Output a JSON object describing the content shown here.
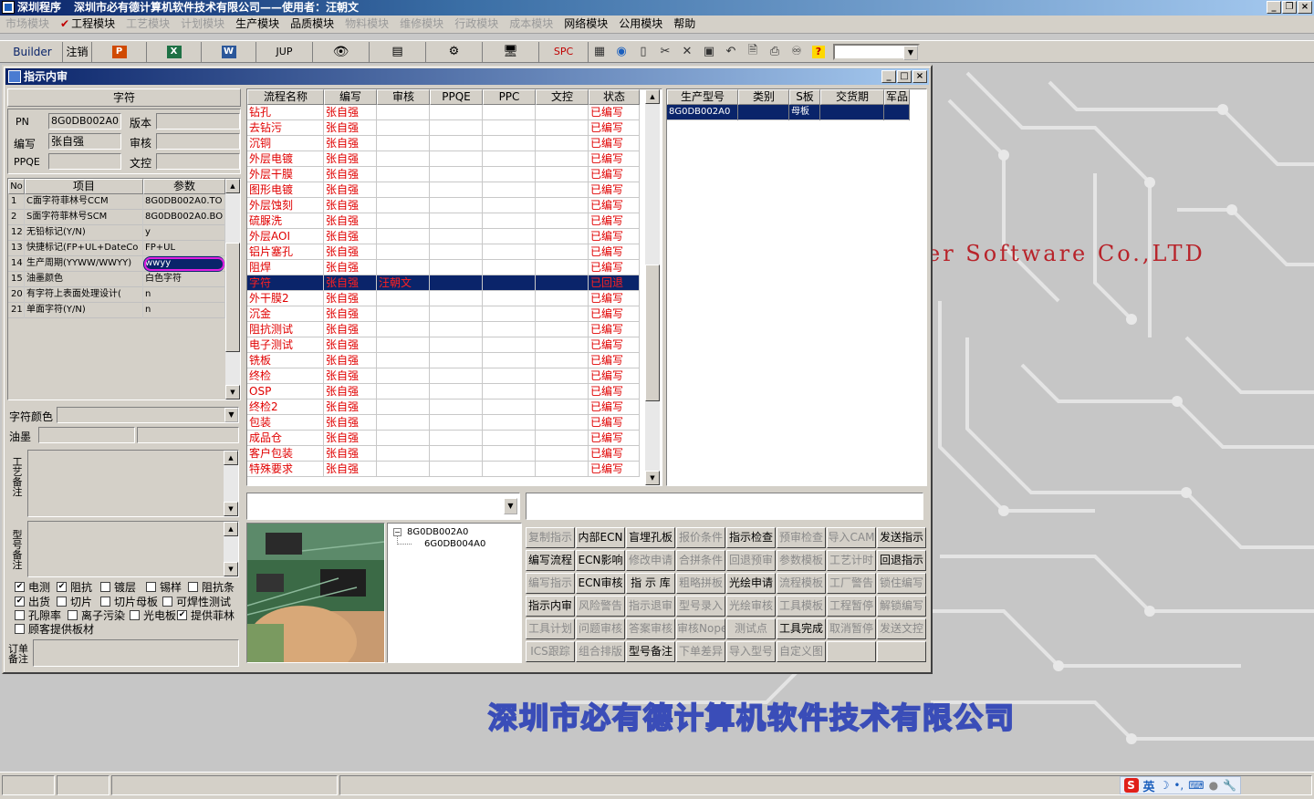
{
  "app": {
    "name": "深圳程序",
    "title": "深圳市必有德计算机软件技术有限公司——使用者：汪朝文"
  },
  "menu": [
    {
      "label": "市场模块",
      "enabled": false
    },
    {
      "label": "工程模块",
      "enabled": true,
      "checked": true
    },
    {
      "label": "工艺模块",
      "enabled": false
    },
    {
      "label": "计划模块",
      "enabled": false
    },
    {
      "label": "生产模块",
      "enabled": true
    },
    {
      "label": "品质模块",
      "enabled": true
    },
    {
      "label": "物料模块",
      "enabled": false
    },
    {
      "label": "维修模块",
      "enabled": false
    },
    {
      "label": "行政模块",
      "enabled": false
    },
    {
      "label": "成本模块",
      "enabled": false
    },
    {
      "label": "网络模块",
      "enabled": true
    },
    {
      "label": "公用模块",
      "enabled": true
    },
    {
      "label": "帮助",
      "enabled": true
    }
  ],
  "toolbar": {
    "builder": "Builder",
    "logout": "注销",
    "jup": "JUP",
    "spc": "SPC"
  },
  "window": {
    "title": "指示内审"
  },
  "left": {
    "section_title": "字符",
    "pn_label": "PN",
    "pn_value": "8G0DB002A0",
    "version_label": "版本",
    "version_value": "",
    "editor_label": "编写",
    "editor_value": "张自强",
    "review_label": "审核",
    "review_value": "",
    "ppqe_label": "PPQE",
    "ppqe_value": "",
    "doc_label": "文控",
    "doc_value": "",
    "params_headers": [
      "No",
      "项目",
      "参数"
    ],
    "params": [
      {
        "no": "1",
        "item": "C面字符菲林号CCM",
        "value": "8G0DB002A0.TO"
      },
      {
        "no": "2",
        "item": "S面字符菲林号SCM",
        "value": "8G0DB002A0.BO"
      },
      {
        "no": "12",
        "item": "无铅标记(Y/N)",
        "value": "y"
      },
      {
        "no": "13",
        "item": "快捷标记(FP+UL+DateCo",
        "value": "FP+UL"
      },
      {
        "no": "14",
        "item": "生产周期(YYWW/WWYY)",
        "value": "wwyy"
      },
      {
        "no": "15",
        "item": "油墨颜色",
        "value": "白色字符"
      },
      {
        "no": "20",
        "item": "有字符上表面处理设计(",
        "value": "n"
      },
      {
        "no": "21",
        "item": "单面字符(Y/N)",
        "value": "n"
      }
    ],
    "color_label": "字符颜色",
    "color_value": "",
    "ink_label": "油墨",
    "process_note_label": "工艺备注",
    "model_note_label": "型号备注",
    "checkboxes": [
      {
        "label": "电测",
        "checked": true
      },
      {
        "label": "阻抗",
        "checked": true
      },
      {
        "label": "镀层",
        "checked": false
      },
      {
        "label": "锡样",
        "checked": false
      },
      {
        "label": "阻抗条",
        "checked": false
      },
      {
        "label": "出货",
        "checked": true
      },
      {
        "label": "切片",
        "checked": false
      },
      {
        "label": "切片母板",
        "checked": false
      },
      {
        "label": "可焊性测试",
        "checked": false
      },
      {
        "label": "孔隙率",
        "checked": false
      },
      {
        "label": "离子污染",
        "checked": false
      },
      {
        "label": "光电板",
        "checked": false
      },
      {
        "label": "提供菲林",
        "checked": true
      },
      {
        "label": "顾客提供板材",
        "checked": false
      }
    ],
    "order_note_label": "订单备注"
  },
  "flow": {
    "headers": [
      "流程名称",
      "编写",
      "审核",
      "PPQE",
      "PPC",
      "文控",
      "状态"
    ],
    "rows": [
      {
        "name": "钻孔",
        "editor": "张自强",
        "review": "",
        "status": "已编写"
      },
      {
        "name": "去钻污",
        "editor": "张自强",
        "review": "",
        "status": "已编写"
      },
      {
        "name": "沉铜",
        "editor": "张自强",
        "review": "",
        "status": "已编写"
      },
      {
        "name": "外层电镀",
        "editor": "张自强",
        "review": "",
        "status": "已编写"
      },
      {
        "name": "外层干膜",
        "editor": "张自强",
        "review": "",
        "status": "已编写"
      },
      {
        "name": "图形电镀",
        "editor": "张自强",
        "review": "",
        "status": "已编写"
      },
      {
        "name": "外层蚀刻",
        "editor": "张自强",
        "review": "",
        "status": "已编写"
      },
      {
        "name": "硫脲洗",
        "editor": "张自强",
        "review": "",
        "status": "已编写"
      },
      {
        "name": "外层AOI",
        "editor": "张自强",
        "review": "",
        "status": "已编写"
      },
      {
        "name": "铝片塞孔",
        "editor": "张自强",
        "review": "",
        "status": "已编写"
      },
      {
        "name": "阻焊",
        "editor": "张自强",
        "review": "",
        "status": "已编写"
      },
      {
        "name": "字符",
        "editor": "张自强",
        "review": "汪朝文",
        "status": "已回退",
        "selected": true
      },
      {
        "name": "外干膜2",
        "editor": "张自强",
        "review": "",
        "status": "已编写"
      },
      {
        "name": "沉金",
        "editor": "张自强",
        "review": "",
        "status": "已编写"
      },
      {
        "name": "阻抗测试",
        "editor": "张自强",
        "review": "",
        "status": "已编写"
      },
      {
        "name": "电子测试",
        "editor": "张自强",
        "review": "",
        "status": "已编写"
      },
      {
        "name": "铣板",
        "editor": "张自强",
        "review": "",
        "status": "已编写"
      },
      {
        "name": "终检",
        "editor": "张自强",
        "review": "",
        "status": "已编写"
      },
      {
        "name": "OSP",
        "editor": "张自强",
        "review": "",
        "status": "已编写"
      },
      {
        "name": "终检2",
        "editor": "张自强",
        "review": "",
        "status": "已编写"
      },
      {
        "name": "包装",
        "editor": "张自强",
        "review": "",
        "status": "已编写"
      },
      {
        "name": "成品仓",
        "editor": "张自强",
        "review": "",
        "status": "已编写"
      },
      {
        "name": "客户包装",
        "editor": "张自强",
        "review": "",
        "status": "已编写"
      },
      {
        "name": "特殊要求",
        "editor": "张自强",
        "review": "",
        "status": "已编写"
      }
    ]
  },
  "products": {
    "headers": [
      "生产型号",
      "类别",
      "S板",
      "交货期",
      "军品"
    ],
    "rows": [
      {
        "model": "8G0DB002A0",
        "category": "",
        "s_board": "母板",
        "delivery": "",
        "military": ""
      }
    ]
  },
  "tree": {
    "root": "8G0DB002A0",
    "child": "6G0DB004A0"
  },
  "buttons": [
    [
      {
        "label": "复制指示",
        "enabled": false
      },
      {
        "label": "内部ECN",
        "enabled": true
      },
      {
        "label": "盲埋孔板",
        "enabled": true
      },
      {
        "label": "报价条件",
        "enabled": false
      },
      {
        "label": "指示检查",
        "enabled": true
      },
      {
        "label": "预审检查",
        "enabled": false
      },
      {
        "label": "导入CAM",
        "enabled": false
      },
      {
        "label": "发送指示",
        "enabled": true
      }
    ],
    [
      {
        "label": "编写流程",
        "enabled": true
      },
      {
        "label": "ECN影响",
        "enabled": true
      },
      {
        "label": "修改申请",
        "enabled": false
      },
      {
        "label": "合拼条件",
        "enabled": false
      },
      {
        "label": "回退预审",
        "enabled": false
      },
      {
        "label": "参数模板",
        "enabled": false
      },
      {
        "label": "工艺计时",
        "enabled": false
      },
      {
        "label": "回退指示",
        "enabled": true
      }
    ],
    [
      {
        "label": "编写指示",
        "enabled": false
      },
      {
        "label": "ECN审核",
        "enabled": true
      },
      {
        "label": "指 示 库",
        "enabled": true
      },
      {
        "label": "粗略拼板",
        "enabled": false
      },
      {
        "label": "光绘申请",
        "enabled": true
      },
      {
        "label": "流程模板",
        "enabled": false
      },
      {
        "label": "工厂警告",
        "enabled": false
      },
      {
        "label": "锁住编写",
        "enabled": false
      }
    ],
    [
      {
        "label": "指示内审",
        "enabled": true
      },
      {
        "label": "风险警告",
        "enabled": false
      },
      {
        "label": "指示退审",
        "enabled": false
      },
      {
        "label": "型号录入",
        "enabled": false
      },
      {
        "label": "光绘审核",
        "enabled": false
      },
      {
        "label": "工具模板",
        "enabled": false
      },
      {
        "label": "工程暂停",
        "enabled": false
      },
      {
        "label": "解锁编写",
        "enabled": false
      }
    ],
    [
      {
        "label": "工具计划",
        "enabled": false
      },
      {
        "label": "问题审核",
        "enabled": false
      },
      {
        "label": "答案审核",
        "enabled": false
      },
      {
        "label": "审核Nope",
        "enabled": false
      },
      {
        "label": "测试点",
        "enabled": false
      },
      {
        "label": "工具完成",
        "enabled": true
      },
      {
        "label": "取消暂停",
        "enabled": false
      },
      {
        "label": "发送文控",
        "enabled": false
      }
    ],
    [
      {
        "label": "ICS跟踪",
        "enabled": false
      },
      {
        "label": "组合排版",
        "enabled": false
      },
      {
        "label": "型号备注",
        "enabled": true
      },
      {
        "label": "下单差异",
        "enabled": false
      },
      {
        "label": "导入型号",
        "enabled": false
      },
      {
        "label": "自定义图",
        "enabled": false
      },
      {
        "label": "",
        "enabled": false
      },
      {
        "label": "",
        "enabled": false
      }
    ]
  ],
  "background": {
    "watermark": "er Software Co.,LTD",
    "company": "深圳市必有德计算机软件技术有限公司"
  },
  "tray": {
    "ime": "英"
  }
}
